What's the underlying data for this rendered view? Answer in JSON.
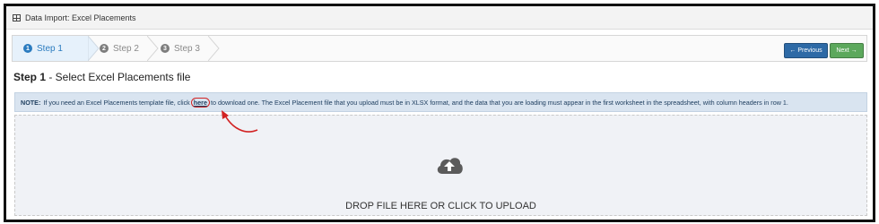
{
  "panel": {
    "title": "Data Import: Excel Placements",
    "icon": "grid-icon"
  },
  "steps": [
    {
      "number": "1",
      "label": "Step 1",
      "active": true
    },
    {
      "number": "2",
      "label": "Step 2",
      "active": false
    },
    {
      "number": "3",
      "label": "Step 3",
      "active": false
    }
  ],
  "nav": {
    "previous_label": "← Previous",
    "next_label": "Next →",
    "previous_color": "#2e6aa6",
    "next_color": "#5ca85c"
  },
  "heading": {
    "bold": "Step 1",
    "rest": " - Select Excel Placements file"
  },
  "note": {
    "label": "NOTE:",
    "before": "If you need an Excel Placements template file, click",
    "link": "here",
    "after": "to download one. The Excel Placement file that you upload must be in XLSX format, and the data that you are loading must appear in the first worksheet in the spreadsheet, with column headers in row 1."
  },
  "dropzone": {
    "text": "DROP FILE HERE OR CLICK TO UPLOAD",
    "icon": "cloud-upload-icon"
  },
  "colors": {
    "accent": "#2a7bbf",
    "highlight": "#d22323"
  }
}
